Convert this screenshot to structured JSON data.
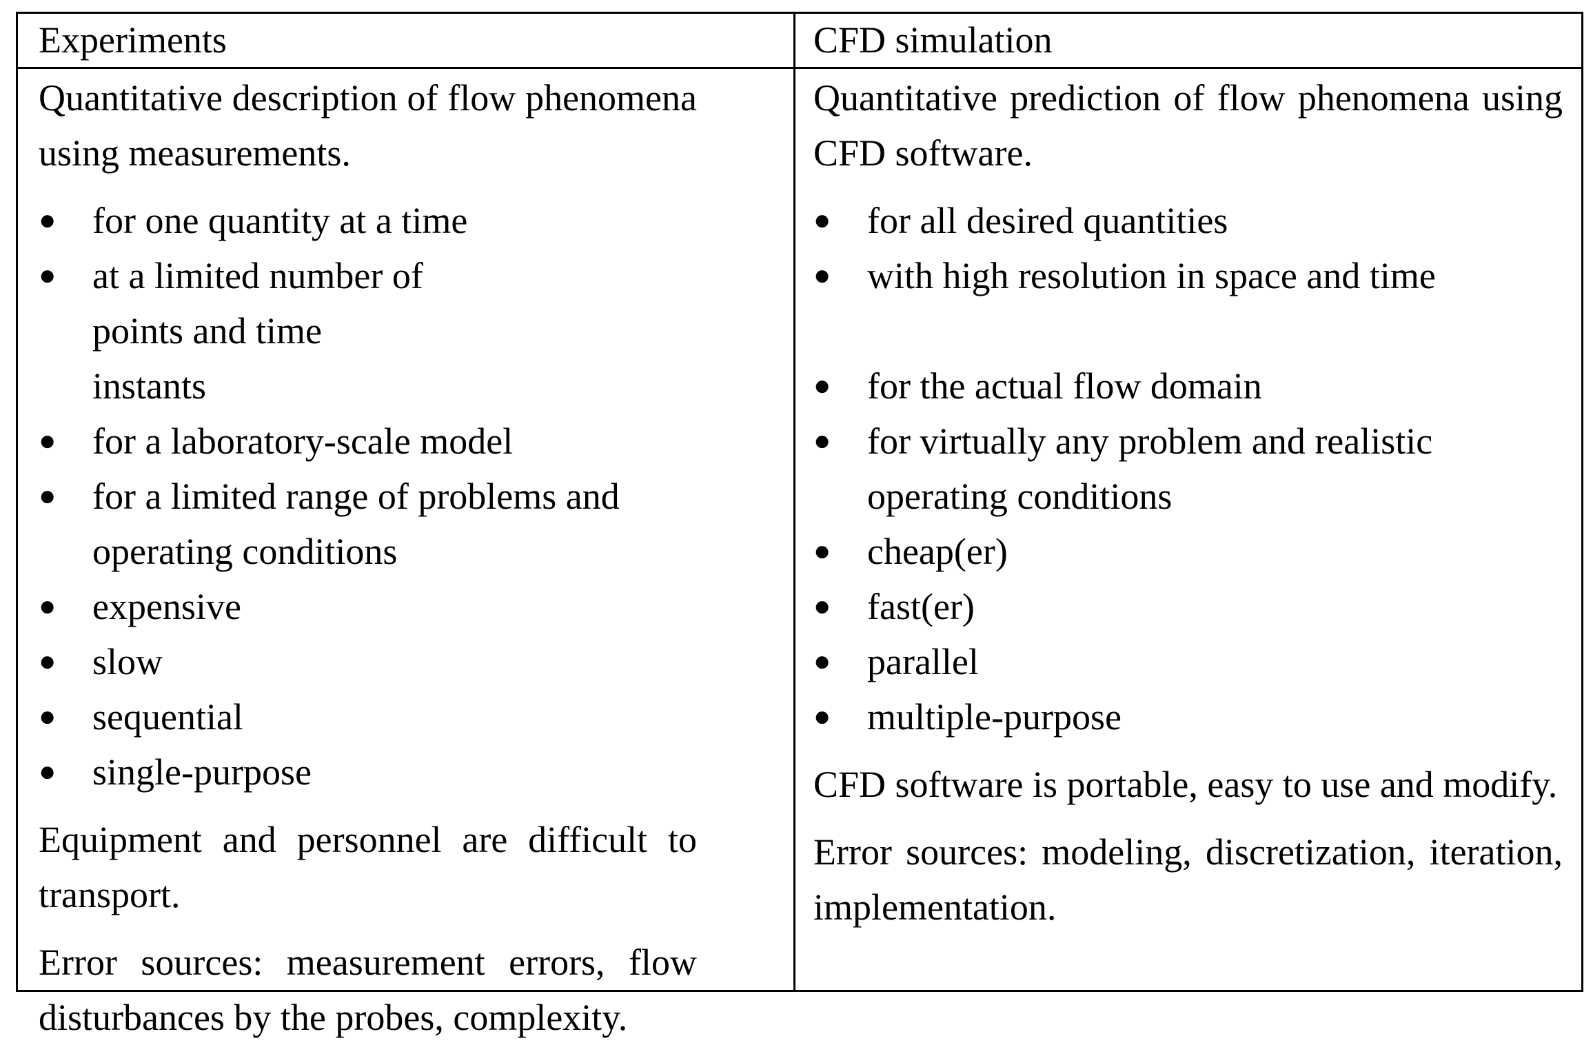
{
  "table": {
    "columns": [
      {
        "header": "Experiments",
        "intro": "Quantitative description of flow phenomena using measurements.",
        "bullets": [
          "for one quantity at a time",
          "at a limited number of points and time instants",
          "for a laboratory-scale model",
          "for a limited range of problems and operating conditions",
          "expensive",
          "slow",
          "sequential",
          "single-purpose"
        ],
        "portability": "Equipment and personnel are difficult to transport.",
        "errors": "Error sources: measurement errors, flow disturbances by the probes, complexity."
      },
      {
        "header": "CFD simulation",
        "intro": "Quantitative prediction of flow phenomena using CFD software.",
        "bullets": [
          "for all desired quantities",
          "with high resolution in space and time",
          "for the actual flow domain",
          "for virtually any problem and realistic operating conditions",
          "cheap(er)",
          "fast(er)",
          "parallel",
          "multiple-purpose"
        ],
        "portability": "CFD software is portable, easy to use and modify.",
        "errors": "Error sources: modeling, discretization, iteration, implementation."
      }
    ],
    "bullet_glyph": "●"
  }
}
